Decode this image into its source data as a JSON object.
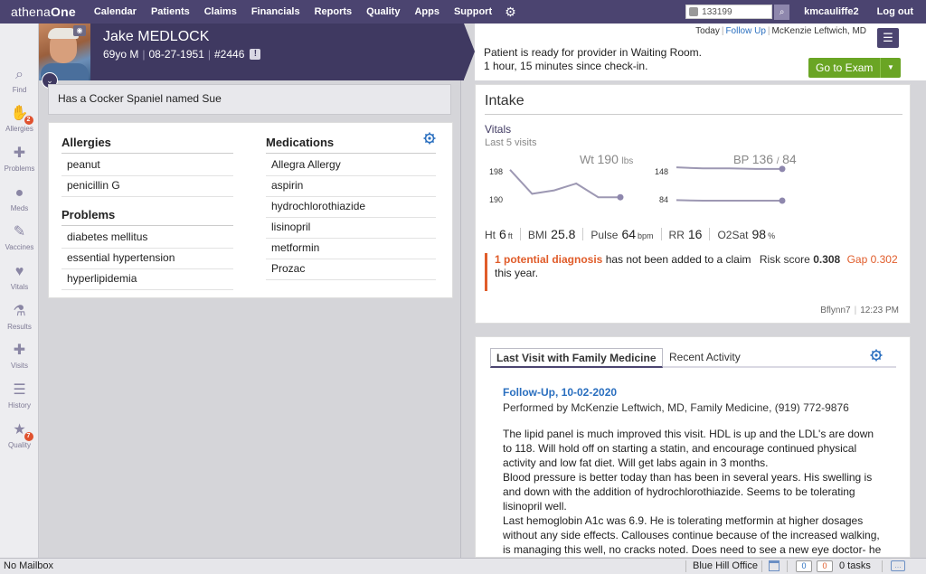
{
  "nav": {
    "logo_prefix": "athena",
    "logo_suffix": "One",
    "items": [
      "Calendar",
      "Patients",
      "Claims",
      "Financials",
      "Reports",
      "Quality",
      "Apps",
      "Support"
    ],
    "search_value": "133199",
    "username": "kmcauliffe2",
    "logout": "Log out"
  },
  "rail": [
    {
      "label": "Find",
      "icon": "search-icon",
      "glyph": "⌕"
    },
    {
      "label": "Allergies",
      "icon": "hand-icon",
      "glyph": "✋",
      "badge": "2"
    },
    {
      "label": "Problems",
      "icon": "bandage-icon",
      "glyph": "✚"
    },
    {
      "label": "Meds",
      "icon": "pill-icon",
      "glyph": "●"
    },
    {
      "label": "Vaccines",
      "icon": "syringe-icon",
      "glyph": "✎"
    },
    {
      "label": "Vitals",
      "icon": "heart-icon",
      "glyph": "♥"
    },
    {
      "label": "Results",
      "icon": "flask-icon",
      "glyph": "⚗"
    },
    {
      "label": "Visits",
      "icon": "clinic-icon",
      "glyph": "✚"
    },
    {
      "label": "History",
      "icon": "clipboard-icon",
      "glyph": "☰"
    },
    {
      "label": "Quality",
      "icon": "star-icon",
      "glyph": "★",
      "badge": "7"
    }
  ],
  "patient": {
    "name": "Jake MEDLOCK",
    "age_sex": "69yo M",
    "dob": "08-27-1951",
    "id": "#2446",
    "alert": "!"
  },
  "status": {
    "today": "Today",
    "follow_up": "Follow Up",
    "provider": "McKenzie Leftwich, MD",
    "line1": "Patient is ready for provider in Waiting Room.",
    "line2": "1 hour, 15 minutes since check-in.",
    "go_exam": "Go to Exam"
  },
  "note": "Has a Cocker Spaniel named Sue",
  "allergies": {
    "title": "Allergies",
    "items": [
      "peanut",
      "penicillin G"
    ]
  },
  "problems": {
    "title": "Problems",
    "items": [
      "diabetes mellitus",
      "essential hypertension",
      "hyperlipidemia"
    ]
  },
  "medications": {
    "title": "Medications",
    "items": [
      "Allegra Allergy",
      "aspirin",
      "hydrochlorothiazide",
      "lisinopril",
      "metformin",
      "Prozac"
    ]
  },
  "intake": {
    "title": "Intake",
    "vitals_title": "Vitals",
    "vitals_sub": "Last 5 visits",
    "wt_label": "Wt",
    "wt_value": "190",
    "wt_unit": "lbs",
    "bp_label": "BP",
    "bp_value": "136",
    "bp_sep": "/",
    "bp_value2": "84",
    "wt_axis": [
      "198",
      "190"
    ],
    "bp_axis": [
      "148",
      "84"
    ],
    "ht_label": "Ht",
    "ht_value": "6",
    "ht_unit": "ft",
    "bmi_label": "BMI",
    "bmi_value": "25.8",
    "pulse_label": "Pulse",
    "pulse_value": "64",
    "pulse_unit": "bpm",
    "rr_label": "RR",
    "rr_value": "16",
    "o2_label": "O2Sat",
    "o2_value": "98",
    "o2_unit": "%",
    "diag_warn": "1 potential diagnosis",
    "diag_text": " has not been added to a claim",
    "risk_label": "Risk score",
    "risk_value": "0.308",
    "gap_label": "Gap",
    "gap_value": "0.302",
    "diag_text2": "this year.",
    "footer_user": "Bflynn7",
    "footer_time": "12:23 PM",
    "wt_series": [
      198,
      191,
      192,
      194,
      190,
      190
    ],
    "bp_sys_series": [
      148,
      146,
      146,
      145,
      145
    ],
    "bp_dia_series": [
      85,
      84,
      84,
      84,
      84
    ]
  },
  "visit": {
    "tab1": "Last Visit with Family Medicine",
    "tab2": "Recent Activity",
    "title": "Follow-Up, 10-02-2020",
    "performed_by": "Performed by McKenzie Leftwich, MD, Family Medicine, (919) 772-9876",
    "body": [
      "The lipid panel is much improved this visit. HDL is up and the LDL's are down to 118. Will hold off on starting a statin, and encourage continued physical activity and low fat diet. Will get labs again in 3 months.",
      "Blood pressure is better today than has been in several years. His swelling is and down with the addition of hydrochlorothiazide. Seems to be tolerating lisinopril well.",
      "Last hemoglobin A1c was 6.9. He is tolerating metformin at higher dosages without any side effects. Callouses continue because of the increased walking, is managing this well, no cracks noted. Does need to see a new eye doctor- he"
    ]
  },
  "footer": {
    "mailbox": "No Mailbox",
    "office": "Blue Hill Office",
    "count1": "0",
    "count2": "0",
    "tasks": "0 tasks"
  }
}
